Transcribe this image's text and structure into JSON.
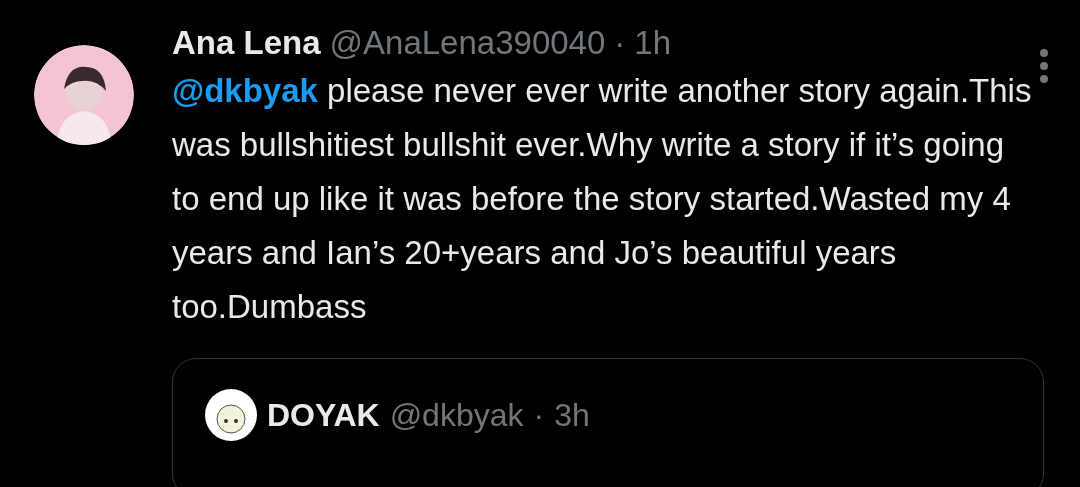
{
  "tweet": {
    "author_name": "Ana Lena",
    "handle": "@AnaLena390040",
    "separator": "·",
    "time": "1h",
    "mention": "@dkbyak",
    "text": "please never ever write another story again.This was bullshitiest bullshit ever.Why write a story if it’s going to end up like it was before the story started.Wasted my 4 years and Ian’s 20+years and Jo’s beautiful years too.Dumbass"
  },
  "quoted_tweet": {
    "author_name": "DOYAK",
    "handle": "@dkbyak",
    "separator": "·",
    "time": "3h"
  }
}
